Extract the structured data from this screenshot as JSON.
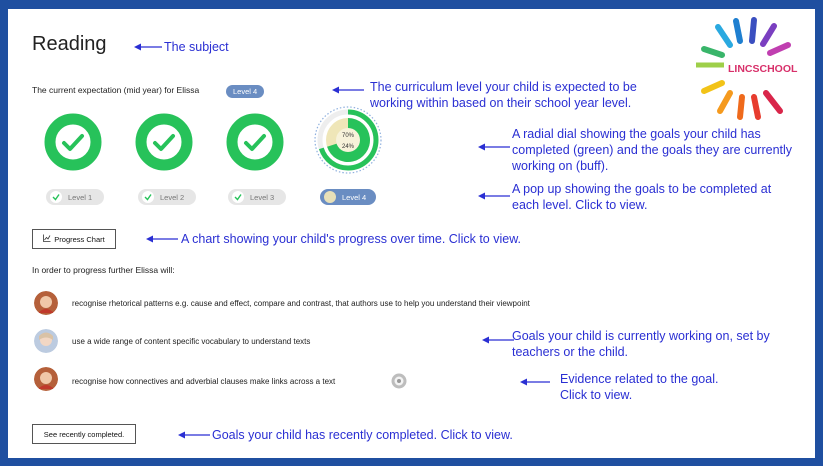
{
  "subject": {
    "title": "Reading",
    "annotation": "The subject"
  },
  "expectation": {
    "text": "The current expectation (mid year) for Elissa",
    "level_badge": "Level 4",
    "annotation_line1": "The curriculum level your child is expected to be",
    "annotation_line2": "working within based on their school year level."
  },
  "dial": {
    "completed_pct_label": "70%",
    "working_pct_label": "24%",
    "completed_fraction": 0.7,
    "working_fraction": 0.24,
    "annotation_line1": "A radial dial showing the goals your child has",
    "annotation_line2": "completed (green) and the goals they are currently",
    "annotation_line3": "working on (buff)."
  },
  "levels": [
    {
      "label": "Level 1",
      "state": "complete"
    },
    {
      "label": "Level 2",
      "state": "complete"
    },
    {
      "label": "Level 3",
      "state": "complete"
    },
    {
      "label": "Level 4",
      "state": "current"
    }
  ],
  "levels_annotation_line1": "A pop up showing the goals to be completed at",
  "levels_annotation_line2": "each level. Click to view.",
  "progress_chart": {
    "label": "Progress Chart",
    "annotation": "A chart showing your child's progress over time. Click to view."
  },
  "progress_intro": "In order to progress further Elissa will:",
  "goals": [
    {
      "text": "recognise rhetorical patterns e.g. cause and effect, compare and contrast, that authors use to help you understand their viewpoint",
      "avatar": "teacher-avatar"
    },
    {
      "text": "use a wide range of content specific vocabulary to understand texts",
      "avatar": "child-avatar"
    },
    {
      "text": "recognise how connectives and adverbial clauses make links across a text",
      "avatar": "teacher-avatar"
    }
  ],
  "goals_annotation_line1": "Goals your child is currently working on, set by",
  "goals_annotation_line2": "teachers or the child.",
  "evidence_annotation_line1": "Evidence related to the goal.",
  "evidence_annotation_line2": "Click to view.",
  "recent": {
    "label": "See recently completed.",
    "annotation": "Goals your child has recently completed. Click to view."
  },
  "logo": {
    "text": "LINCSCHOOL"
  },
  "colors": {
    "frame": "#1f4fa0",
    "annotation": "#2a2fd3",
    "green": "#27c25a",
    "buff": "#efe6b8",
    "badge": "#6a8dc2"
  }
}
